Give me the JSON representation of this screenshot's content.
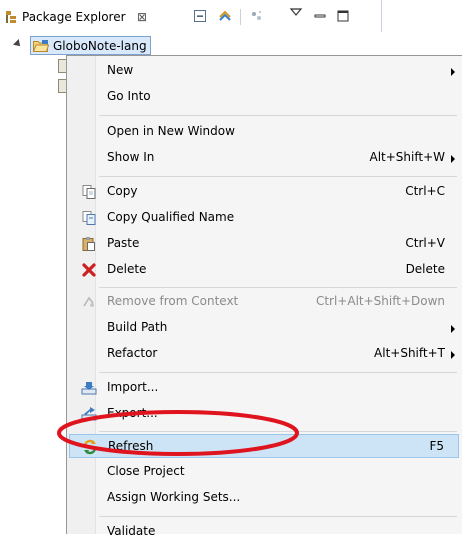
{
  "view": {
    "title": "Package Explorer",
    "close_glyph": "⊠",
    "project_name": "GloboNote-lang"
  },
  "menu": {
    "items": [
      {
        "label": "New",
        "shortcut": "",
        "submenu": true,
        "icon": "",
        "enabled": true
      },
      {
        "label": "Go Into",
        "shortcut": "",
        "submenu": false,
        "icon": "",
        "enabled": true
      },
      {
        "label": "Open in New Window",
        "shortcut": "",
        "submenu": false,
        "icon": "",
        "enabled": true
      },
      {
        "label": "Show In",
        "shortcut": "Alt+Shift+W",
        "submenu": true,
        "icon": "",
        "enabled": true
      },
      {
        "label": "Copy",
        "shortcut": "Ctrl+C",
        "submenu": false,
        "icon": "copy-icon",
        "enabled": true
      },
      {
        "label": "Copy Qualified Name",
        "shortcut": "",
        "submenu": false,
        "icon": "copy-qualified-name-icon",
        "enabled": true
      },
      {
        "label": "Paste",
        "shortcut": "Ctrl+V",
        "submenu": false,
        "icon": "paste-icon",
        "enabled": true
      },
      {
        "label": "Delete",
        "shortcut": "Delete",
        "submenu": false,
        "icon": "delete-icon",
        "enabled": true
      },
      {
        "label": "Remove from Context",
        "shortcut": "Ctrl+Alt+Shift+Down",
        "submenu": false,
        "icon": "remove-context-icon",
        "enabled": false
      },
      {
        "label": "Build Path",
        "shortcut": "",
        "submenu": true,
        "icon": "",
        "enabled": true
      },
      {
        "label": "Refactor",
        "shortcut": "Alt+Shift+T",
        "submenu": true,
        "icon": "",
        "enabled": true
      },
      {
        "label": "Import...",
        "shortcut": "",
        "submenu": false,
        "icon": "import-icon",
        "enabled": true
      },
      {
        "label": "Export...",
        "shortcut": "",
        "submenu": false,
        "icon": "export-icon",
        "enabled": true
      },
      {
        "label": "Refresh",
        "shortcut": "F5",
        "submenu": false,
        "icon": "refresh-icon",
        "enabled": true,
        "highlighted": true
      },
      {
        "label": "Close Project",
        "shortcut": "",
        "submenu": false,
        "icon": "",
        "enabled": true
      },
      {
        "label": "Assign Working Sets...",
        "shortcut": "",
        "submenu": false,
        "icon": "",
        "enabled": true
      },
      {
        "label": "Validate",
        "shortcut": "",
        "submenu": false,
        "icon": "",
        "enabled": true
      }
    ]
  },
  "colors": {
    "hover_bg": "#cde4f7",
    "annotation_red": "#e0141e",
    "delete_red": "#cc1f1f"
  }
}
